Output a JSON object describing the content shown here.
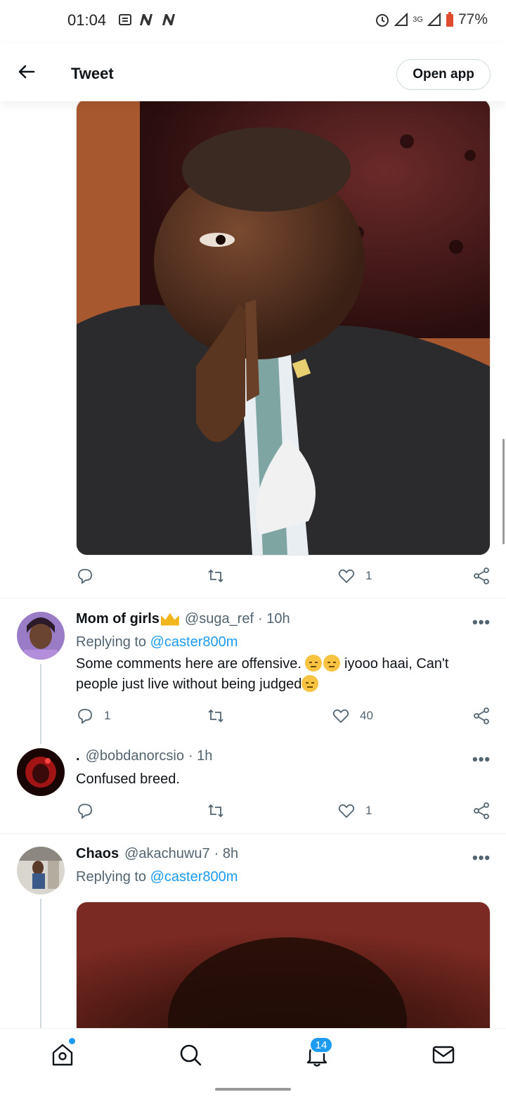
{
  "status_bar": {
    "time": "01:04",
    "battery": "77%",
    "network": "3G"
  },
  "header": {
    "title": "Tweet",
    "open_app": "Open app"
  },
  "main_tweet": {
    "likes": "1"
  },
  "replies": [
    {
      "name": "Mom of girls",
      "handle": "@suga_ref",
      "time": "· 10h",
      "replying_prefix": "Replying to",
      "replying_to": "@caster800m",
      "text_part1": "Some comments here are offensive.",
      "text_part2": "iyooo haai, Can't people just live without being judged",
      "reply_count": "1",
      "like_count": "40"
    },
    {
      "name": ".",
      "handle": "@bobdanorcsio",
      "time": "· 1h",
      "text": "Confused breed.",
      "like_count": "1"
    },
    {
      "name": "Chaos",
      "handle": "@akachuwu7",
      "time": "· 8h",
      "replying_prefix": "Replying to",
      "replying_to": "@caster800m"
    }
  ],
  "more_label": "•••",
  "bottom_nav": {
    "notifications_badge": "14"
  },
  "colors": {
    "accent": "#1d9bf0",
    "text": "#0f1419",
    "secondary": "#536471"
  }
}
